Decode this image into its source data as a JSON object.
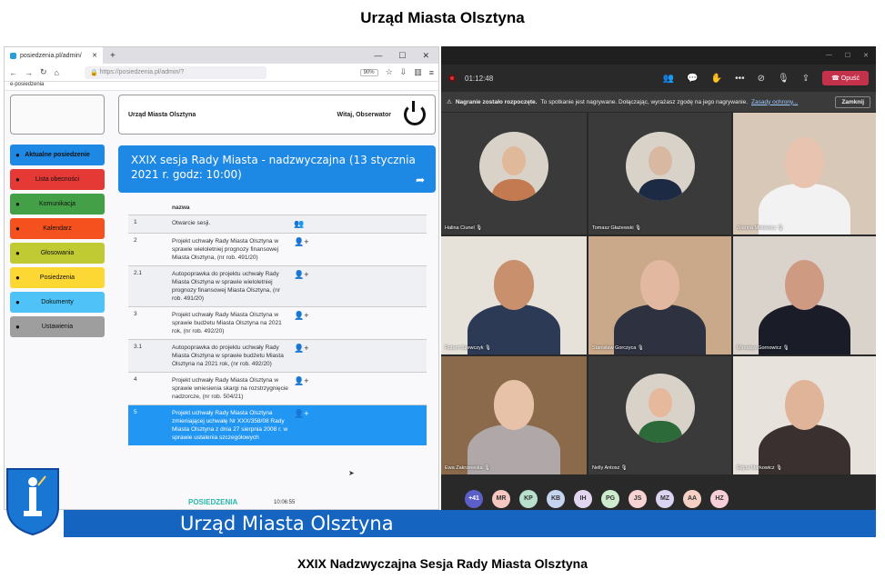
{
  "top_title": "Urząd Miasta Olsztyna",
  "bottom_title": "XXIX Nadzwyczajna Sesja Rady Miasta Olsztyna",
  "banner_text": "Urząd Miasta Olsztyna",
  "browser": {
    "tab_title": "posiedzenia.pl/admin/",
    "url": "https://posiedzenia.pl/admin/?",
    "zoom": "90%",
    "bookmark": "e-posiedzenia",
    "header_org": "Urząd Miasta Olsztyna",
    "welcome": "Witaj, Obserwator",
    "session_title": "XXIX sesja Rady Miasta - nadzwyczajna (13 stycznia 2021 r. godz: 10:00)",
    "menu": [
      {
        "label": "Aktualne posiedzenie",
        "color": "#1e88e5",
        "icon": "people-icon"
      },
      {
        "label": "Lista obecności",
        "color": "#e53935",
        "icon": "list-icon"
      },
      {
        "label": "Komunikacja",
        "color": "#43a047",
        "icon": "mail-icon"
      },
      {
        "label": "Kalendarz",
        "color": "#f4511e",
        "icon": "calendar-icon"
      },
      {
        "label": "Głosowania",
        "color": "#c0ca33",
        "icon": "hand-icon"
      },
      {
        "label": "Posiedzenia",
        "color": "#fdd835",
        "icon": "group-icon"
      },
      {
        "label": "Dokumenty",
        "color": "#4fc3f7",
        "icon": "paperclip-icon"
      },
      {
        "label": "Ustawienia",
        "color": "#9e9e9e",
        "icon": "lock-icon"
      }
    ],
    "agenda_header": "nazwa",
    "agenda": [
      {
        "num": "1",
        "text": "Otwarcie sesji."
      },
      {
        "num": "2",
        "text": "Projekt uchwały Rady Miasta Olsztyna w sprawie wieloletniej prognozy finansowej Miasta Olsztyna, (nr rob. 491/20)"
      },
      {
        "num": "2.1",
        "text": "Autopoprawka do projektu uchwały Rady Miasta Olsztyna w sprawie wieloletniej prognozy finansowej Miasta Olsztyna, (nr rob. 491/20)"
      },
      {
        "num": "3",
        "text": "Projekt uchwały Rady Miasta Olsztyna w sprawie budżetu Miasta Olsztyna na 2021 rok, (nr rob. 492/20)"
      },
      {
        "num": "3.1",
        "text": "Autopoprawka do projektu uchwały Rady Miasta Olsztyna w sprawie budżetu Miasta Olsztyna na 2021 rok, (nr rob. 492/20)"
      },
      {
        "num": "4",
        "text": "Projekt uchwały Rady Miasta Olsztyna w sprawie wniesienia skargi na rozstrzygnięcie nadzorcze, (nr rob. 504/21)"
      },
      {
        "num": "5",
        "text": "Projekt uchwały Rady Miasta Olsztyna zmieniającej uchwałę Nr XXX/358/08 Rady Miasta Olsztyna z dnia 27 sierpnia 2008 r. w sprawie ustalenia szczegółowych"
      }
    ],
    "footer_logo": "POSIEDZENIA",
    "footer_time": "10:06:55"
  },
  "teams": {
    "timer": "01:12:48",
    "leave_label": "Opuść",
    "notice_bold": "Nagranie zostało rozpoczęte.",
    "notice_text": "To spotkanie jest nagrywane. Dołączając, wyrażasz zgodę na jego nagrywanie.",
    "notice_link": "Zasady ochrony...",
    "close_label": "Zamknij",
    "participants": [
      {
        "name": "Halina Ciunel",
        "bg": "#3a3a3a",
        "skin": "#e0b89a",
        "shirt": "#c47a50"
      },
      {
        "name": "Tomasz Głażewski",
        "bg": "#3a3a3a",
        "skin": "#d8b8a0",
        "shirt": "#1d2a44"
      },
      {
        "name": "Joanna Misiewicz",
        "bg": "#d8c8b8",
        "skin": "#e8c4b0",
        "shirt": "#f2f2f2"
      },
      {
        "name": "Robert Szewczyk",
        "bg": "#e6e2da",
        "skin": "#c9906e",
        "shirt": "#2c3a55"
      },
      {
        "name": "Stanisław Gorczyca",
        "bg": "#c9a98a",
        "skin": "#e2b8a0",
        "shirt": "#2e3240"
      },
      {
        "name": "Mirosław Gornowicz",
        "bg": "#d9d3cc",
        "skin": "#cf9a82",
        "shirt": "#1a1d28"
      },
      {
        "name": "Ewa Zakrzewska",
        "bg": "#8a6a4a",
        "skin": "#e8c2a8",
        "shirt": "#b0a8a8"
      },
      {
        "name": "Nelly Antosz",
        "bg": "#3a3a3a",
        "skin": "#e6b89c",
        "shirt": "#2d6a3a"
      },
      {
        "name": "Edyta Markowicz",
        "bg": "#e8e2dc",
        "skin": "#e0b498",
        "shirt": "#3a3030"
      }
    ],
    "roster": [
      {
        "initials": "+41",
        "color": "#5b5fc7"
      },
      {
        "initials": "MR",
        "color": "#f4c7c3"
      },
      {
        "initials": "KP",
        "color": "#b7e1cd"
      },
      {
        "initials": "KB",
        "color": "#c5d5f0"
      },
      {
        "initials": "IH",
        "color": "#e1d5f0"
      },
      {
        "initials": "PG",
        "color": "#cdeccd"
      },
      {
        "initials": "JS",
        "color": "#f8d3d3"
      },
      {
        "initials": "MZ",
        "color": "#dcd3f3"
      },
      {
        "initials": "AA",
        "color": "#f5d0c5"
      },
      {
        "initials": "HZ",
        "color": "#f8cfd8"
      }
    ]
  }
}
